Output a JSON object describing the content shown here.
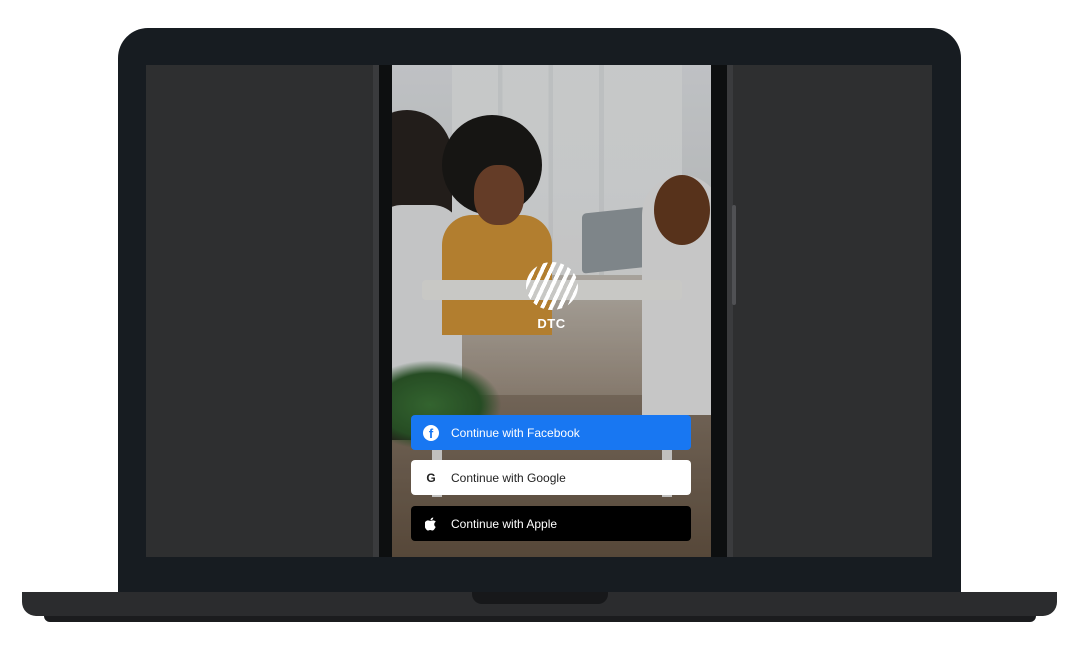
{
  "app": {
    "logo_text": "DTC"
  },
  "auth": {
    "facebook_label": "Continue with Facebook",
    "google_label": "Continue with Google",
    "google_icon_letter": "G",
    "apple_label": "Continue with Apple"
  },
  "colors": {
    "facebook": "#1877f2",
    "google_bg": "#ffffff",
    "apple_bg": "#000000"
  },
  "icons": {
    "facebook": "facebook-icon",
    "google": "google-icon",
    "apple": "apple-icon",
    "logo": "dtc-logo-icon"
  }
}
